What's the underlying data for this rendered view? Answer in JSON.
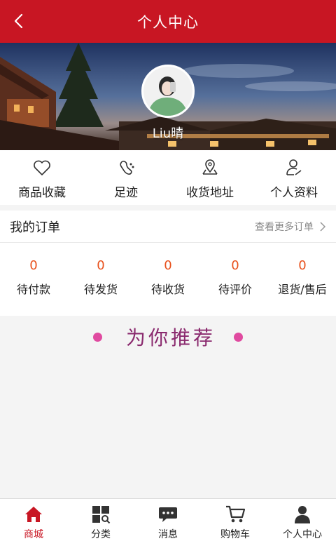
{
  "header": {
    "title": "个人中心",
    "back_icon": "back-arrow-icon"
  },
  "profile": {
    "username": "Liu晴"
  },
  "quick_links": [
    {
      "label": "商品收藏",
      "icon": "heart-icon"
    },
    {
      "label": "足迹",
      "icon": "footprint-icon"
    },
    {
      "label": "收货地址",
      "icon": "map-pin-icon"
    },
    {
      "label": "个人资料",
      "icon": "user-edit-icon"
    }
  ],
  "orders": {
    "title": "我的订单",
    "more_label": "查看更多订单",
    "statuses": [
      {
        "count": "0",
        "label": "待付款"
      },
      {
        "count": "0",
        "label": "待发货"
      },
      {
        "count": "0",
        "label": "待收货"
      },
      {
        "count": "0",
        "label": "待评价"
      },
      {
        "count": "0",
        "label": "退货/售后"
      }
    ]
  },
  "recommend": {
    "title": "为你推荐"
  },
  "tabbar": {
    "active_color": "#c81623",
    "items": [
      {
        "label": "商城",
        "icon": "home-icon",
        "active": true
      },
      {
        "label": "分类",
        "icon": "category-icon",
        "active": false
      },
      {
        "label": "消息",
        "icon": "message-icon",
        "active": false
      },
      {
        "label": "购物车",
        "icon": "cart-icon",
        "active": false
      },
      {
        "label": "个人中心",
        "icon": "user-icon",
        "active": false
      }
    ]
  },
  "colors": {
    "brand": "#c81623",
    "count": "#e8511c",
    "recommend_dot": "#e04aa0"
  }
}
